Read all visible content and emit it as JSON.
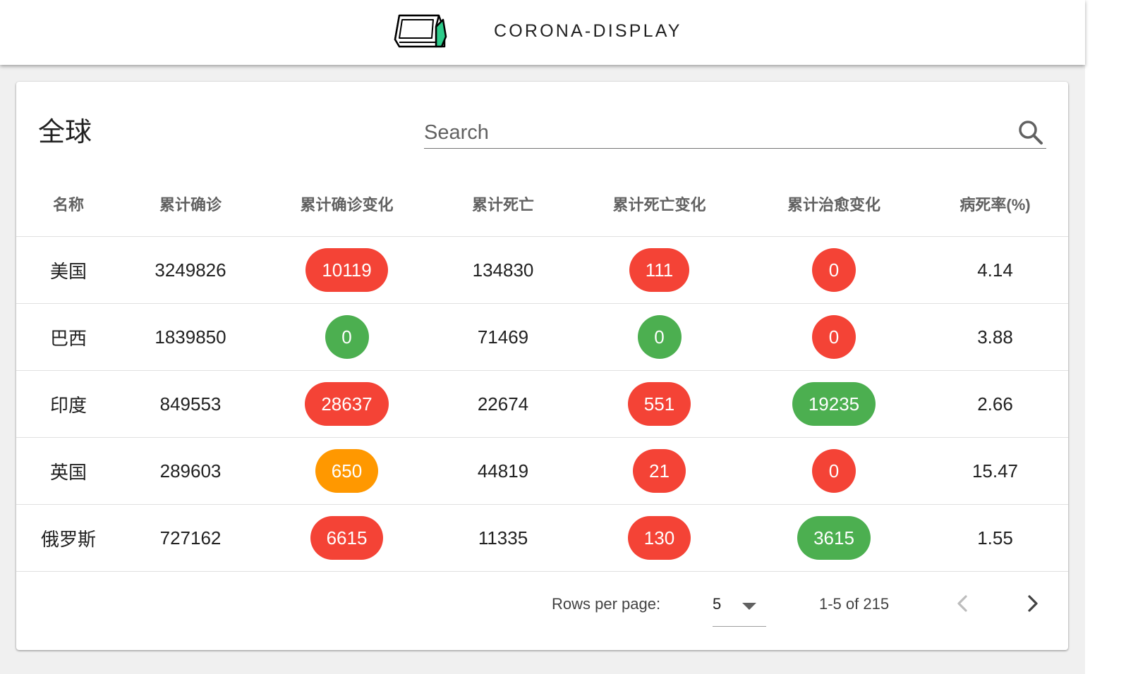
{
  "app": {
    "title": "CORONA-DISPLAY",
    "logo_icon": "monitor-logo-icon"
  },
  "card": {
    "title": "全球"
  },
  "search": {
    "placeholder": "Search",
    "value": "",
    "icon": "search-icon"
  },
  "table": {
    "columns": [
      "名称",
      "累计确诊",
      "累计确诊变化",
      "累计死亡",
      "累计死亡变化",
      "累计治愈变化",
      "病死率(%)"
    ],
    "rows": [
      {
        "name": "美国",
        "confirmed": "3249826",
        "confirmed_change": "10119",
        "confirmed_change_color": "red",
        "deaths": "134830",
        "deaths_change": "111",
        "deaths_change_color": "red",
        "cured_change": "0",
        "cured_change_color": "red",
        "fatality_rate": "4.14"
      },
      {
        "name": "巴西",
        "confirmed": "1839850",
        "confirmed_change": "0",
        "confirmed_change_color": "green",
        "deaths": "71469",
        "deaths_change": "0",
        "deaths_change_color": "green",
        "cured_change": "0",
        "cured_change_color": "red",
        "fatality_rate": "3.88"
      },
      {
        "name": "印度",
        "confirmed": "849553",
        "confirmed_change": "28637",
        "confirmed_change_color": "red",
        "deaths": "22674",
        "deaths_change": "551",
        "deaths_change_color": "red",
        "cured_change": "19235",
        "cured_change_color": "green",
        "fatality_rate": "2.66"
      },
      {
        "name": "英国",
        "confirmed": "289603",
        "confirmed_change": "650",
        "confirmed_change_color": "orange",
        "deaths": "44819",
        "deaths_change": "21",
        "deaths_change_color": "red",
        "cured_change": "0",
        "cured_change_color": "red",
        "fatality_rate": "15.47"
      },
      {
        "name": "俄罗斯",
        "confirmed": "727162",
        "confirmed_change": "6615",
        "confirmed_change_color": "red",
        "deaths": "11335",
        "deaths_change": "130",
        "deaths_change_color": "red",
        "cured_change": "3615",
        "cured_change_color": "green",
        "fatality_rate": "1.55"
      }
    ]
  },
  "pagination": {
    "rows_per_page_label": "Rows per page:",
    "rows_per_page_value": "5",
    "page_info": "1-5 of 215",
    "prev_icon": "chevron-left-icon",
    "next_icon": "chevron-right-icon"
  },
  "colors": {
    "red": "#f44336",
    "green": "#4caf50",
    "orange": "#ff9800",
    "logo_accent": "#2ecc8b"
  }
}
